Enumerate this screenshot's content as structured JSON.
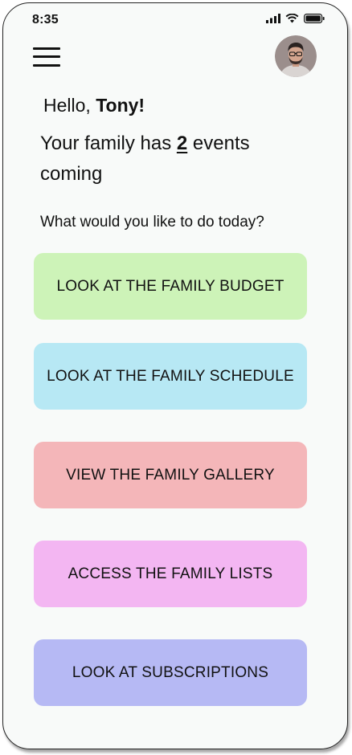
{
  "status_bar": {
    "time": "8:35"
  },
  "header": {
    "menu_icon": "hamburger-menu-icon",
    "avatar_icon": "user-avatar"
  },
  "greeting": {
    "prefix": "Hello, ",
    "name": "Tony!"
  },
  "events": {
    "prefix": "Your family has ",
    "count": "2",
    "suffix": " events coming"
  },
  "prompt": "What would you like to do today?",
  "actions": [
    {
      "label": "LOOK AT THE FAMILY BUDGET",
      "color": "#cdf3b8"
    },
    {
      "label": "LOOK AT THE FAMILY SCHEDULE",
      "color": "#b7e8f4"
    },
    {
      "label": "VIEW THE FAMILY GALLERY",
      "color": "#f4b6b9"
    },
    {
      "label": "ACCESS THE FAMILY LISTS",
      "color": "#f3b6f2"
    },
    {
      "label": "LOOK AT SUBSCRIPTIONS",
      "color": "#b6b9f4"
    }
  ]
}
